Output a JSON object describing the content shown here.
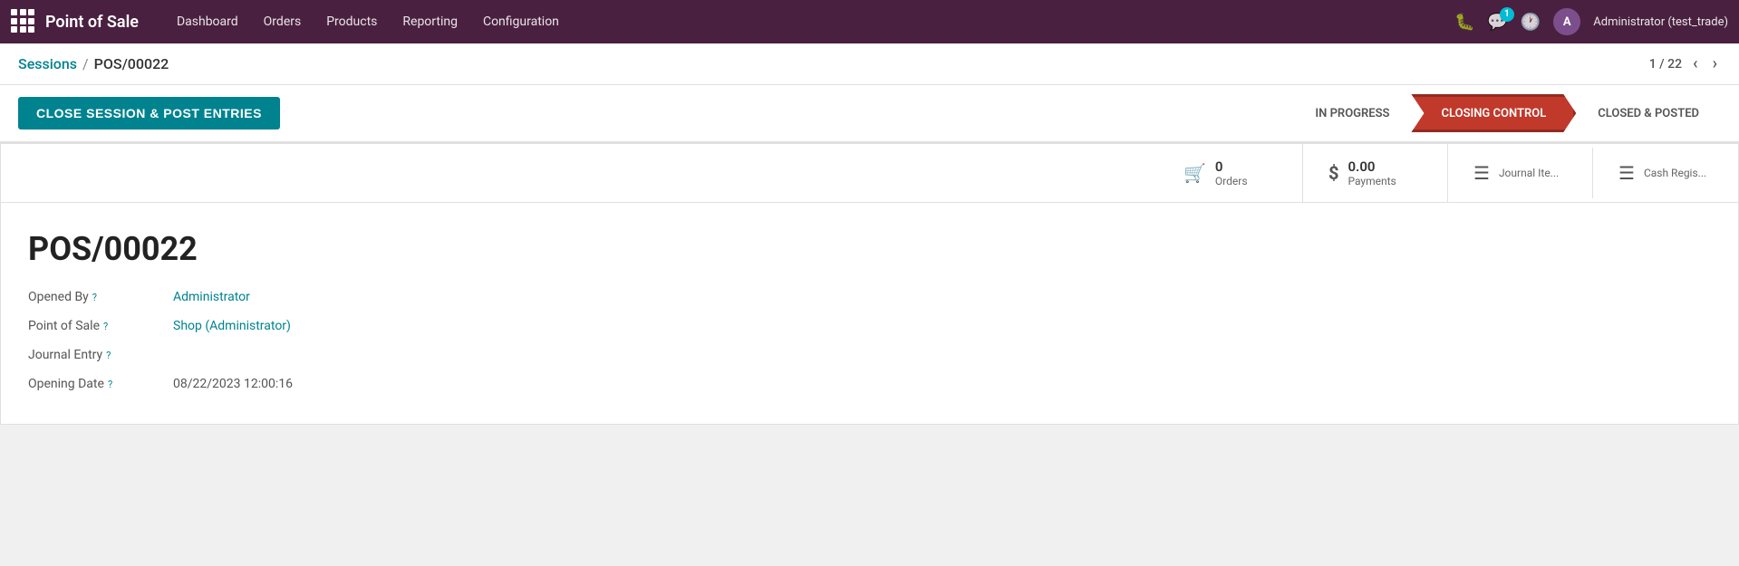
{
  "topnav": {
    "brand": "Point of Sale",
    "menu": [
      {
        "id": "dashboard",
        "label": "Dashboard"
      },
      {
        "id": "orders",
        "label": "Orders"
      },
      {
        "id": "products",
        "label": "Products"
      },
      {
        "id": "reporting",
        "label": "Reporting"
      },
      {
        "id": "configuration",
        "label": "Configuration"
      }
    ],
    "icons": {
      "bug": "🐛",
      "chat": "💬",
      "chat_badge": "1",
      "clock": "🕐"
    },
    "user": {
      "initial": "A",
      "name": "Administrator (test_trade)"
    }
  },
  "breadcrumb": {
    "parent": "Sessions",
    "separator": "/",
    "current": "POS/00022",
    "pagination": "1 / 22"
  },
  "action_bar": {
    "close_session_label": "CLOSE SESSION & POST ENTRIES"
  },
  "status_steps": [
    {
      "id": "in-progress",
      "label": "IN PROGRESS",
      "state": "normal"
    },
    {
      "id": "closing-control",
      "label": "CLOSING CONTROL",
      "state": "active"
    },
    {
      "id": "closed-posted",
      "label": "CLOSED & POSTED",
      "state": "normal"
    }
  ],
  "stats": [
    {
      "id": "orders",
      "icon": "🛒",
      "value": "0",
      "label": "Orders"
    },
    {
      "id": "payments",
      "icon": "$",
      "value": "0.00",
      "label": "Payments"
    },
    {
      "id": "journal-items",
      "icon": "≡",
      "value": "",
      "label": "Journal Ite..."
    },
    {
      "id": "cash-register",
      "icon": "≡",
      "value": "",
      "label": "Cash Regis..."
    }
  ],
  "session": {
    "id": "POS/00022",
    "fields": [
      {
        "id": "opened-by",
        "label": "Opened By",
        "value": "Administrator",
        "has_link": true
      },
      {
        "id": "point-of-sale",
        "label": "Point of Sale",
        "value": "Shop (Administrator)",
        "has_link": true
      },
      {
        "id": "journal-entry",
        "label": "Journal Entry",
        "value": "",
        "has_link": false
      },
      {
        "id": "opening-date",
        "label": "Opening Date",
        "value": "08/22/2023 12:00:16",
        "has_link": false
      }
    ]
  }
}
